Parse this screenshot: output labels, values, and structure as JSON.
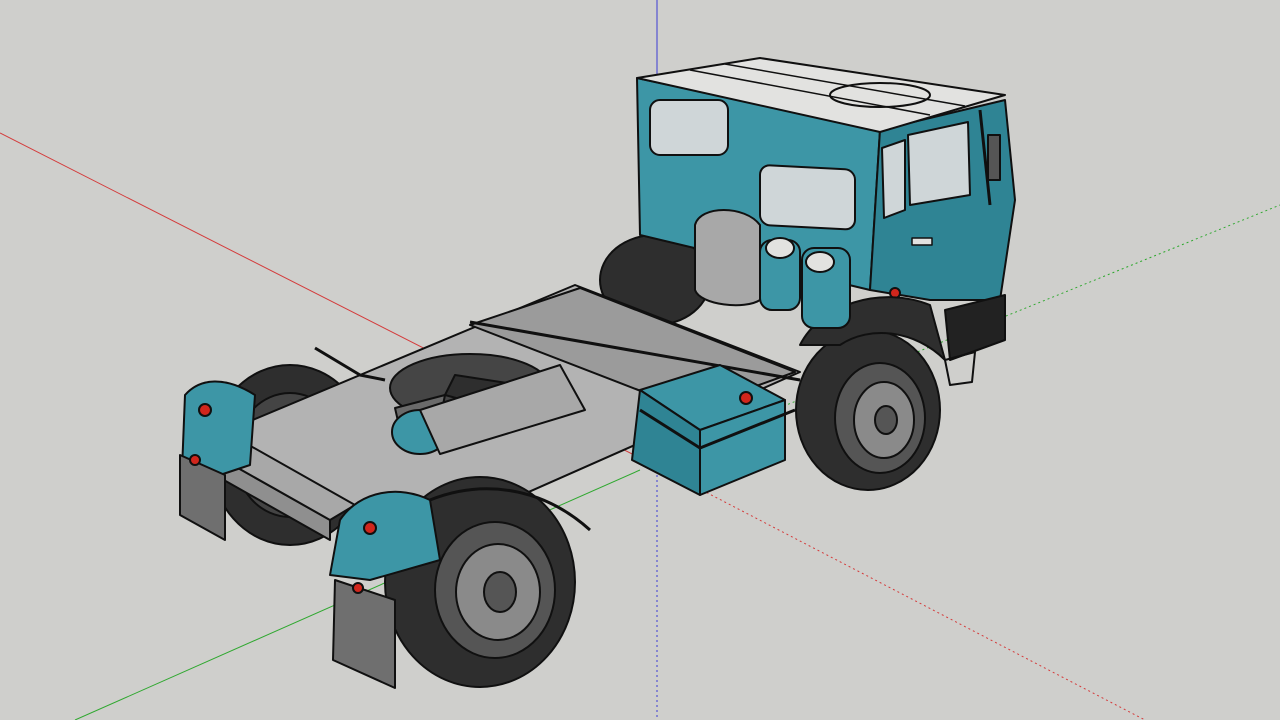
{
  "viewport": {
    "background": "#cfcfcc",
    "axes": {
      "red": "#d43b3b",
      "green": "#2fa82f",
      "blue": "#3b3bd4"
    }
  },
  "model": {
    "subject": "truck-tractor",
    "colors": {
      "body": "#3d96a6",
      "body_dark": "#2c7584",
      "roof": "#e2e2e0",
      "chassis": "#a8a8a8",
      "chassis_dark": "#7d7d7d",
      "tire": "#2e2e2e",
      "rim": "#8a8a8a",
      "glass": "#cfd6d8",
      "lamp": "#d0261c",
      "mudflap": "#6f6f6f",
      "outline": "#101010"
    },
    "icons": [
      "truck-cab",
      "fifth-wheel",
      "fuel-tank",
      "air-tanks",
      "rear-wheels",
      "front-wheels",
      "mudflaps"
    ]
  }
}
